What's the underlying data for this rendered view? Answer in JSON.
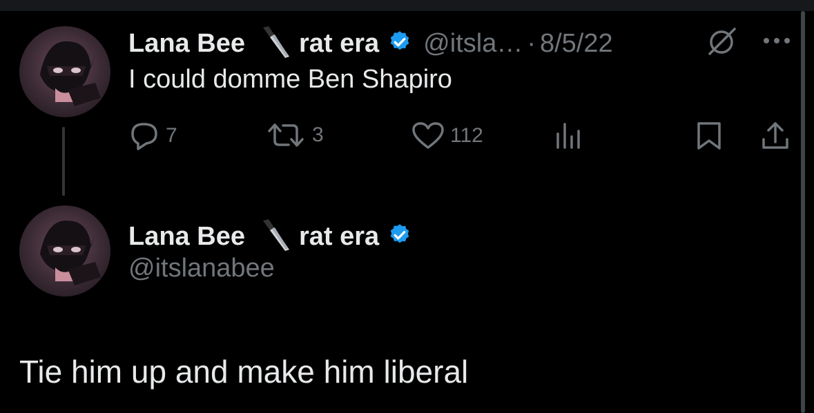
{
  "tweet": {
    "author": {
      "display_name": "Lana Bee",
      "name_suffix": "rat era",
      "handle_truncated": "@itsla…",
      "verified": true,
      "emoji_icon": "knife-icon"
    },
    "separator": "·",
    "date": "8/5/22",
    "text": "I could domme Ben Shapiro",
    "actions": {
      "replies": "7",
      "retweets": "3",
      "likes": "112"
    }
  },
  "reply": {
    "author": {
      "display_name": "Lana Bee",
      "name_suffix": "rat era",
      "handle": "@itslanabee",
      "verified": true
    },
    "text": "Tie him up and make him liberal"
  },
  "colors": {
    "background": "#000000",
    "primary_text": "#e7e9ea",
    "secondary_text": "#71767b",
    "verified_blue": "#1d9bf0"
  }
}
